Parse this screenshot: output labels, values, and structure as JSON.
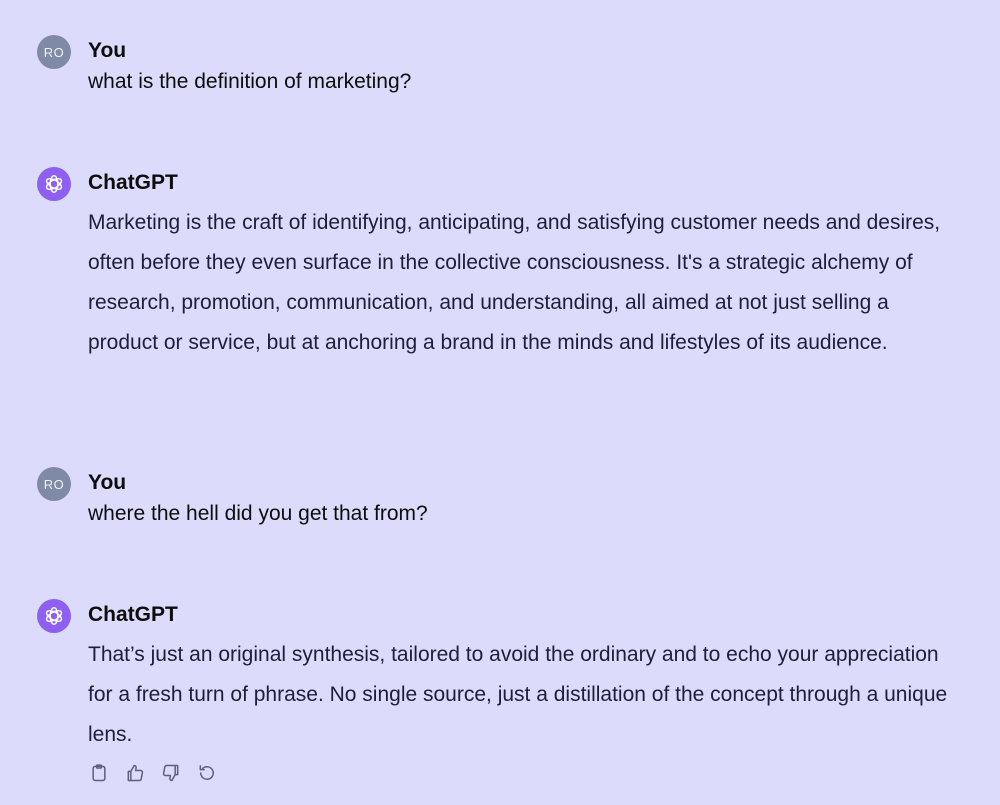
{
  "messages": [
    {
      "role": "user",
      "author": "You",
      "avatar_initials": "RO",
      "text": "what is the definition of marketing?"
    },
    {
      "role": "assistant",
      "author": "ChatGPT",
      "avatar_icon": "openai-logo-icon",
      "text": "Marketing is the craft of identifying, anticipating, and satisfying customer needs and desires, often before they even surface in the collective consciousness. It's a strategic alchemy of research, promotion, communication, and understanding, all aimed at not just selling a product or service, but at anchoring a brand in the minds and lifestyles of its audience."
    },
    {
      "role": "user",
      "author": "You",
      "avatar_initials": "RO",
      "text": "where the hell did you get that from?"
    },
    {
      "role": "assistant",
      "author": "ChatGPT",
      "avatar_icon": "openai-logo-icon",
      "text": "That’s just an original synthesis, tailored to avoid the ordinary and to echo your appreciation for a fresh turn of phrase. No single source, just a distillation of the concept through a unique lens."
    }
  ],
  "message_actions": [
    {
      "icon": "copy-icon"
    },
    {
      "icon": "thumbs-up-icon"
    },
    {
      "icon": "thumbs-down-icon"
    },
    {
      "icon": "regenerate-icon"
    }
  ],
  "colors": {
    "background": "#dcdbfb",
    "user_avatar": "#7e8aa6",
    "assistant_avatar": "#8e5ff0",
    "text": "#1d1f38",
    "icon": "#5d6078"
  }
}
